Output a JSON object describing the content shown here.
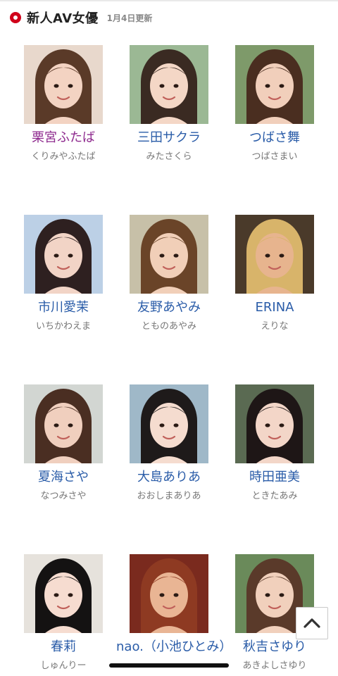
{
  "header": {
    "title": "新人AV女優",
    "updated": "1月4日更新"
  },
  "colors": {
    "accent": "#d0021b",
    "link": "#2a5ca8",
    "visited": "#8e2a8e"
  },
  "actresses": [
    {
      "name": "栗宮ふたば",
      "kana": "くりみやふたば",
      "visited": true
    },
    {
      "name": "三田サクラ",
      "kana": "みたさくら",
      "visited": false
    },
    {
      "name": "つばさ舞",
      "kana": "つばさまい",
      "visited": false
    },
    {
      "name": "市川愛茉",
      "kana": "いちかわえま",
      "visited": false
    },
    {
      "name": "友野あやみ",
      "kana": "とものあやみ",
      "visited": false
    },
    {
      "name": "ERINA",
      "kana": "えりな",
      "visited": false
    },
    {
      "name": "夏海さや",
      "kana": "なつみさや",
      "visited": false
    },
    {
      "name": "大島ありあ",
      "kana": "おおしまありあ",
      "visited": false
    },
    {
      "name": "時田亜美",
      "kana": "ときたあみ",
      "visited": false
    },
    {
      "name": "春莉",
      "kana": "しゅんりー",
      "visited": false
    },
    {
      "name": "nao.（小池ひとみ）",
      "kana": "",
      "visited": false
    },
    {
      "name": "秋吉さゆり",
      "kana": "あきよしさゆり",
      "visited": false
    }
  ],
  "scroll_top": {
    "icon": "chevron-up-icon"
  }
}
